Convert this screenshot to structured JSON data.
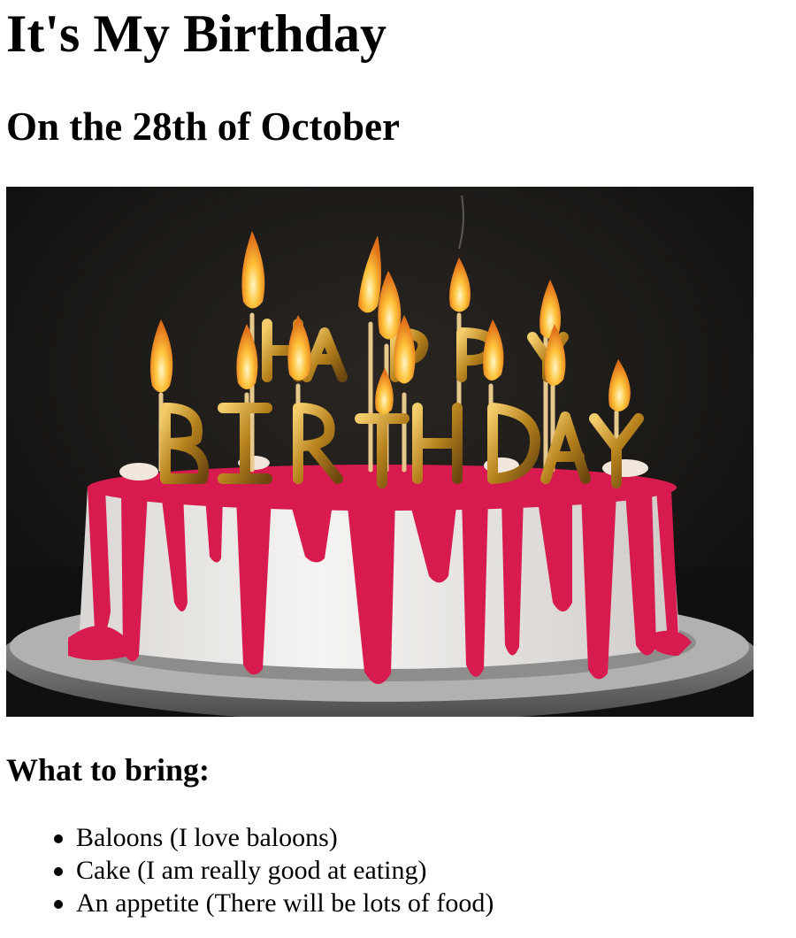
{
  "page": {
    "title": "It's My Birthday",
    "subtitle": "On the 28th of October",
    "section_heading": "What to bring:",
    "items": [
      {
        "label": "Baloons (I love baloons)"
      },
      {
        "label": "Cake (I am really good at eating)"
      },
      {
        "label": "An appetite (There will be lots of food)"
      }
    ]
  },
  "image": {
    "icon": "birthday-cake-photo",
    "colors": {
      "background": "#1c1a18",
      "frosting": "#f2f0ee",
      "icing": "#d81b4f",
      "candle_gold": "#c8931f",
      "flame": "#ffb52e",
      "plate": "#8a8888"
    }
  }
}
